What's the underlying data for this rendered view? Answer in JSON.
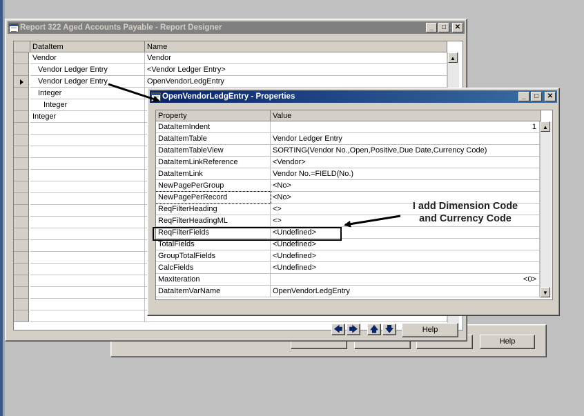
{
  "designer": {
    "title": "Report 322 Aged Accounts Payable - Report Designer",
    "columns": [
      "DataItem",
      "Name"
    ],
    "rows": [
      {
        "dataitem": "Vendor",
        "name": "Vendor",
        "indent": 0,
        "current": false
      },
      {
        "dataitem": "Vendor Ledger Entry",
        "name": "<Vendor Ledger Entry>",
        "indent": 1,
        "current": false
      },
      {
        "dataitem": "Vendor Ledger Entry",
        "name": "OpenVendorLedgEntry",
        "indent": 1,
        "current": true
      },
      {
        "dataitem": "Integer",
        "name": "",
        "indent": 1,
        "current": false
      },
      {
        "dataitem": "Integer",
        "name": "",
        "indent": 2,
        "current": false
      },
      {
        "dataitem": "Integer",
        "name": "‹",
        "indent": 0,
        "current": false
      }
    ],
    "help_label": "Help",
    "nav_buttons": [
      "left-arrow",
      "right-arrow",
      "up-arrow",
      "down-arrow"
    ]
  },
  "back_window": {
    "help_label": "Help"
  },
  "properties": {
    "title": "OpenVendorLedgEntry - Properties",
    "columns": [
      "Property",
      "Value"
    ],
    "rows": [
      {
        "property": "DataItemIndent",
        "value": "1",
        "align": "right"
      },
      {
        "property": "DataItemTable",
        "value": "Vendor Ledger Entry",
        "align": "left"
      },
      {
        "property": "DataItemTableView",
        "value": "SORTING(Vendor No.,Open,Positive,Due Date,Currency Code)",
        "align": "left"
      },
      {
        "property": "DataItemLinkReference",
        "value": "<Vendor>",
        "align": "left"
      },
      {
        "property": "DataItemLink",
        "value": "Vendor No.=FIELD(No.)",
        "align": "left"
      },
      {
        "property": "NewPagePerGroup",
        "value": "<No>",
        "align": "left"
      },
      {
        "property": "NewPagePerRecord",
        "value": "<No>",
        "align": "left"
      },
      {
        "property": "ReqFilterHeading",
        "value": "<>",
        "align": "left"
      },
      {
        "property": "ReqFilterHeadingML",
        "value": "<>",
        "align": "left"
      },
      {
        "property": "ReqFilterFields",
        "value": "<Undefined>",
        "align": "left"
      },
      {
        "property": "TotalFields",
        "value": "<Undefined>",
        "align": "left"
      },
      {
        "property": "GroupTotalFields",
        "value": "<Undefined>",
        "align": "left"
      },
      {
        "property": "CalcFields",
        "value": "<Undefined>",
        "align": "left"
      },
      {
        "property": "MaxIteration",
        "value": "<0>",
        "align": "right"
      },
      {
        "property": "DataItemVarName",
        "value": "OpenVendorLedgEntry",
        "align": "left"
      }
    ]
  },
  "annotation": {
    "line1": "I add Dimension Code",
    "line2": "and Currency Code"
  },
  "window_buttons": {
    "minimize": "_",
    "maximize": "□",
    "close": "✕"
  },
  "colors": {
    "active_title_start": "#0a246a",
    "active_title_end": "#3a6ea5",
    "inactive_title": "#808080",
    "face": "#d4d0c8"
  }
}
